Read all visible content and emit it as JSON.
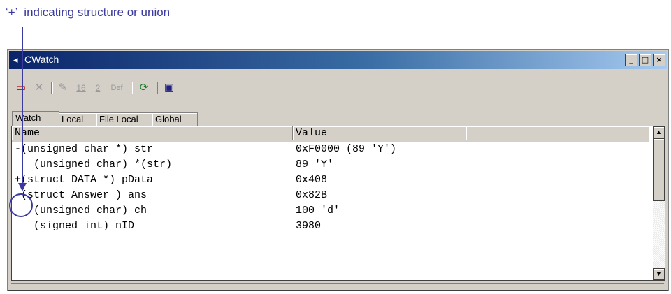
{
  "annotation": {
    "text": "‘+’  indicating structure or union"
  },
  "window": {
    "title": "CWatch",
    "icon": "cwatch-app-icon",
    "controls": {
      "minimize": "_",
      "maximize": "□",
      "close": "×"
    }
  },
  "toolbar": {
    "items": [
      {
        "icon": "add-watch-icon",
        "label": "▭"
      },
      {
        "icon": "delete-icon",
        "label": "✕"
      },
      {
        "icon": "edit-pencil-icon",
        "label": "✎"
      },
      {
        "icon": "hex-radix-icon",
        "label": "16"
      },
      {
        "icon": "binary-radix-icon",
        "label": "2"
      },
      {
        "icon": "default-radix-icon",
        "label": "Def"
      },
      {
        "icon": "refresh-icon",
        "label": "⟳"
      },
      {
        "icon": "window-icon",
        "label": "▣"
      }
    ]
  },
  "tabs": [
    "Watch",
    "Local",
    "File Local",
    "Global"
  ],
  "table": {
    "columns": [
      "Name",
      "Value"
    ],
    "rows": [
      {
        "name": "-(unsigned char *) str",
        "value": "0xF0000 (89 'Y')"
      },
      {
        "name": "   (unsigned char) *(str)",
        "value": "89 'Y'"
      },
      {
        "name": "+(struct DATA *) pData",
        "value": "0x408"
      },
      {
        "name": "-(struct Answer ) ans",
        "value": "0x82B"
      },
      {
        "name": "   (unsigned char) ch",
        "value": "100 'd'"
      },
      {
        "name": "   (signed int) nID",
        "value": "3980"
      }
    ]
  },
  "colors": {
    "accent": "#3a3aa0",
    "titlebar": "#0a246a",
    "face": "#d4d0c8"
  }
}
